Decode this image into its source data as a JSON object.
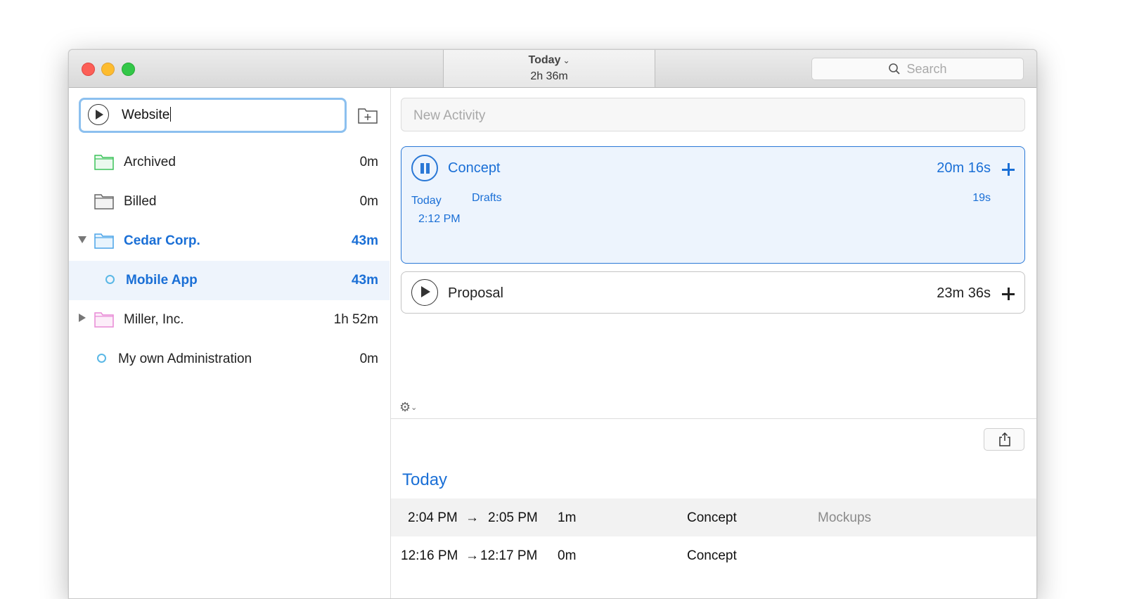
{
  "titlebar": {
    "period_label": "Today",
    "period_total": "2h 36m",
    "search_placeholder": "Search"
  },
  "sidebar": {
    "project_input_value": "Website",
    "items": [
      {
        "name": "Archived",
        "time": "0m",
        "folder_color": "#3cc35a"
      },
      {
        "name": "Billed",
        "time": "0m",
        "folder_color": "#777777"
      },
      {
        "name": "Cedar Corp.",
        "time": "43m",
        "folder_color": "#4aa3e8",
        "expanded": true
      },
      {
        "name": "Mobile App",
        "time": "43m",
        "selected": true
      },
      {
        "name": "Miller, Inc.",
        "time": "1h 52m",
        "folder_color": "#e88ad6",
        "expanded": false
      },
      {
        "name": "My own Administration",
        "time": "0m"
      }
    ]
  },
  "main": {
    "new_activity_placeholder": "New Activity",
    "activities": [
      {
        "name": "Concept",
        "time": "20m 16s",
        "running": true,
        "entry": {
          "date": "Today",
          "time": "2:12 PM",
          "note": "Drafts",
          "duration": "19s"
        }
      },
      {
        "name": "Proposal",
        "time": "23m 36s",
        "running": false
      }
    ],
    "log": {
      "heading": "Today",
      "rows": [
        {
          "start": "2:04 PM",
          "arrow": "→",
          "end": "2:05 PM",
          "duration": "1m",
          "activity": "Concept",
          "note": "Mockups"
        },
        {
          "start": "12:16 PM",
          "arrow": "→",
          "end": "12:17 PM",
          "duration": "0m",
          "activity": "Concept",
          "note": ""
        }
      ]
    }
  },
  "colors": {
    "accent": "#1a6fd6",
    "selected_row": "#eef4fc",
    "active_card": "#edf4fd"
  },
  "icons": [
    "search-icon",
    "play-icon",
    "add-folder-icon",
    "folder-icon",
    "pause-icon",
    "plus-icon",
    "gear-icon",
    "share-icon"
  ]
}
